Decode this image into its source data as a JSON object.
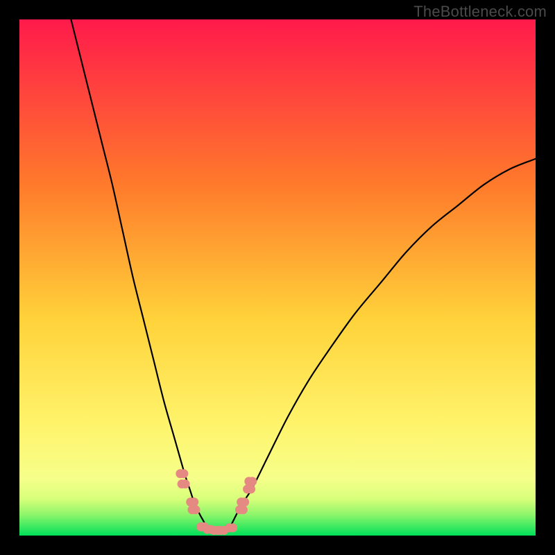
{
  "watermark": "TheBottleneck.com",
  "colors": {
    "bg": "#000000",
    "grad_top": "#ff1a4b",
    "grad_mid1": "#ff7a2b",
    "grad_mid2": "#ffd23a",
    "grad_low": "#fff36a",
    "grad_green": "#00e05a",
    "curve": "#000000",
    "marker": "#e58a82"
  },
  "chart_data": {
    "type": "line",
    "title": "",
    "xlabel": "",
    "ylabel": "",
    "xlim": [
      0,
      100
    ],
    "ylim": [
      0,
      100
    ],
    "series": [
      {
        "name": "bottleneck-curve-left",
        "x": [
          10,
          12,
          14,
          16,
          18,
          20,
          22,
          24,
          26,
          28,
          30,
          32,
          33,
          34,
          35,
          36
        ],
        "y": [
          100,
          92,
          84,
          76,
          68,
          59,
          50,
          42,
          34,
          26,
          19,
          12,
          9,
          6,
          4,
          2
        ]
      },
      {
        "name": "bottleneck-curve-right",
        "x": [
          41,
          42,
          43,
          45,
          48,
          52,
          56,
          60,
          65,
          70,
          75,
          80,
          85,
          90,
          95,
          100
        ],
        "y": [
          2,
          4,
          6,
          9,
          15,
          23,
          30,
          36,
          43,
          49,
          55,
          60,
          64,
          68,
          71,
          73
        ]
      },
      {
        "name": "floor",
        "x": [
          35,
          36,
          37,
          38,
          39,
          40,
          41
        ],
        "y": [
          1.8,
          1.3,
          1.0,
          1.0,
          1.0,
          1.3,
          1.8
        ]
      }
    ],
    "markers": [
      {
        "x": 31.5,
        "y": 12
      },
      {
        "x": 31.8,
        "y": 10
      },
      {
        "x": 33.5,
        "y": 6.5
      },
      {
        "x": 33.8,
        "y": 5
      },
      {
        "x": 35.5,
        "y": 1.7
      },
      {
        "x": 36.7,
        "y": 1.2
      },
      {
        "x": 38,
        "y": 1.0
      },
      {
        "x": 39.3,
        "y": 1.0
      },
      {
        "x": 41,
        "y": 1.5
      },
      {
        "x": 43,
        "y": 5
      },
      {
        "x": 43.3,
        "y": 6.5
      },
      {
        "x": 44.5,
        "y": 9
      },
      {
        "x": 44.8,
        "y": 10.5
      }
    ]
  }
}
